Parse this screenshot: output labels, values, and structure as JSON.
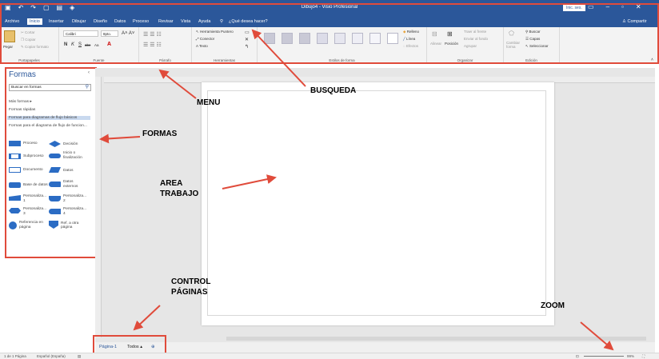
{
  "titlebar": {
    "title": "Dibujo4 - Visio Profesional",
    "signin": "Inic. ses.",
    "qat_icons": [
      "save-icon",
      "undo-icon",
      "redo-icon",
      "new-icon",
      "open-icon",
      "shapes-icon"
    ],
    "window_controls": [
      "ribbon-display-icon",
      "minimize-icon",
      "maximize-icon",
      "close-icon"
    ]
  },
  "tabs": {
    "items": [
      "Archivo",
      "Inicio",
      "Insertar",
      "Dibujar",
      "Diseño",
      "Datos",
      "Proceso",
      "Revisar",
      "Vista",
      "Ayuda"
    ],
    "active": "Inicio",
    "tellme": "¿Qué desea hacer?",
    "share": "Compartir"
  },
  "ribbon": {
    "portapapeles": {
      "label": "Portapapeles",
      "pegar": "Pegar",
      "cortar": "Cortar",
      "copiar": "Copiar",
      "copiar_formato": "Copiar formato"
    },
    "fuente": {
      "label": "Fuente",
      "font": "Calibri",
      "size": "8pto.",
      "bold": "N",
      "italic": "K",
      "underline": "S",
      "strike": "abc",
      "case": "Aa"
    },
    "parrafo": {
      "label": "Párrafo"
    },
    "herramientas": {
      "label": "Herramientas",
      "puntero": "Herramienta Puntero",
      "conector": "Conector",
      "texto": "Texto"
    },
    "estilos": {
      "label": "Estilos de forma",
      "sample": "Abc",
      "relleno": "Relleno",
      "linea": "Línea",
      "efectos": "Efectos"
    },
    "organizar": {
      "label": "Organizar",
      "alinear": "Alinear",
      "posicion": "Posición",
      "traer": "Traer al frente",
      "enviar": "Enviar al fondo",
      "agrupar": "Agrupar"
    },
    "edicion": {
      "label": "Edición",
      "cambiar_forma": "Cambiar forma",
      "buscar": "Buscar",
      "capas": "Capas",
      "seleccionar": "Seleccionar"
    }
  },
  "shapes_panel": {
    "title": "Formas",
    "search_placeholder": "Buscar en formas",
    "more": "Más formas",
    "quick": "Formas rápidas",
    "basic": "Formas para diagramas de flujo básicos",
    "functional": "Formas para el diagrama de flujo de funcion...",
    "shapes": [
      [
        "Proceso",
        "Decisión"
      ],
      [
        "Subproceso",
        "Inicio o finalización"
      ],
      [
        "Documento",
        "Datos"
      ],
      [
        "Base de datos",
        "Datos externos"
      ],
      [
        "Personaliza... 1",
        "Personaliza... 2"
      ],
      [
        "Personaliza... 3",
        "Personaliza... 4"
      ],
      [
        "Referencia en página",
        "Ref. a otra página"
      ]
    ]
  },
  "page_bar": {
    "page": "Página-1",
    "all": "Todos"
  },
  "status": {
    "page_count": "1 de 1 Página",
    "language": "Español (España)",
    "zoom": "99%"
  },
  "callouts": {
    "menu": "MENU",
    "busqueda": "BUSQUEDA",
    "formas": "FORMAS",
    "area": "AREA\nTRABAJO",
    "control": "CONTROL\nPÁGINAS",
    "zoom": "ZOOM"
  },
  "colors": {
    "brand": "#2b579a",
    "callout_red": "#e04b3b",
    "shape_blue": "#2b6cc4"
  }
}
